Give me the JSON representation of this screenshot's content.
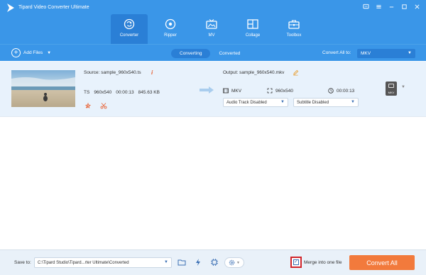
{
  "app": {
    "title": "Tipard Video Converter Ultimate"
  },
  "nav": {
    "tabs": [
      {
        "label": "Converter",
        "icon": "converter-icon",
        "active": true
      },
      {
        "label": "Ripper",
        "icon": "ripper-icon",
        "active": false
      },
      {
        "label": "MV",
        "icon": "mv-icon",
        "active": false
      },
      {
        "label": "Collage",
        "icon": "collage-icon",
        "active": false
      },
      {
        "label": "Toolbox",
        "icon": "toolbox-icon",
        "active": false
      }
    ]
  },
  "toolbar": {
    "add_files": "Add Files",
    "segments": [
      "Converting",
      "Converted"
    ],
    "convert_all_to": "Convert All to:",
    "format_value": "MKV"
  },
  "file": {
    "source": "Source: sample_960x540.ts",
    "src_format": "TS",
    "src_resolution": "960x540",
    "src_duration": "00:00:13",
    "src_size": "845.63 KB",
    "output": "Output: sample_960x540.mkv",
    "out_format": "MKV",
    "out_resolution": "960x540",
    "out_duration": "00:00:13",
    "audio_track": "Audio Track Disabled",
    "subtitle": "Subtitle Disabled",
    "badge": "MKV"
  },
  "bottom": {
    "save_to": "Save to:",
    "path": "C:\\Tipard Studio\\Tipard...rter Ultimate\\Converted",
    "merge": "Merge into one file",
    "merge_checked": true,
    "convert_all": "Convert All"
  },
  "colors": {
    "header_blue": "#3a96e8",
    "active_tab": "#2a7fd6",
    "convert_orange": "#f27a3c",
    "highlight_red": "#d0242a"
  }
}
